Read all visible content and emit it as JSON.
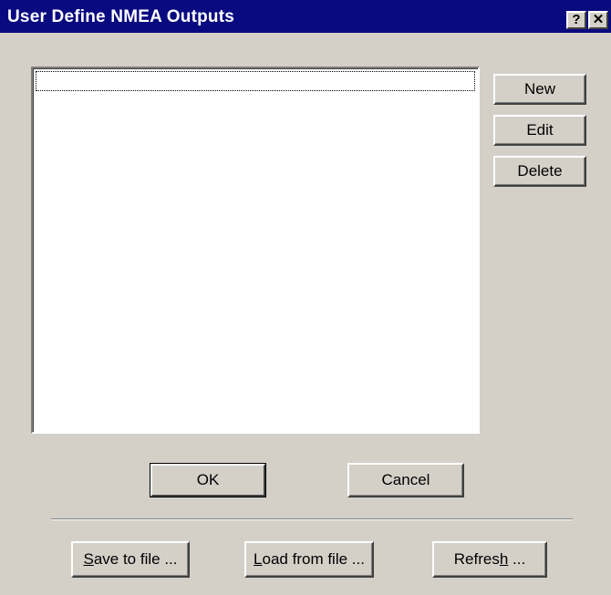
{
  "window": {
    "title": "User Define NMEA Outputs",
    "help_glyph": "?",
    "close_glyph": "✕"
  },
  "list": {
    "items": []
  },
  "side_buttons": {
    "new_label": "New",
    "edit_label": "Edit",
    "delete_label": "Delete"
  },
  "dialog_buttons": {
    "ok_label": "OK",
    "cancel_label": "Cancel"
  },
  "file_buttons": {
    "save_accel": "S",
    "save_rest": "ave to file ...",
    "load_accel": "L",
    "load_rest": "oad from file ...",
    "refresh_pre": "Refres",
    "refresh_accel": "h",
    "refresh_rest": " ..."
  },
  "colors": {
    "titlebar": "#0a0a80",
    "face": "#d4d0c8",
    "list_bg": "#ffffff"
  }
}
